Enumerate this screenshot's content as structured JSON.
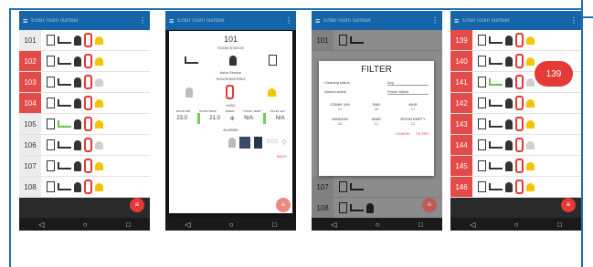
{
  "colors": {
    "accent": "#1565a8",
    "alert": "#e53935",
    "bell": "#f5c400"
  },
  "search": {
    "placeholder": "Enter room number"
  },
  "phone1": {
    "rooms": [
      {
        "num": "101",
        "red": false,
        "bed_green": false
      },
      {
        "num": "102",
        "red": true,
        "bed_green": false
      },
      {
        "num": "103",
        "red": true,
        "bed_green": false
      },
      {
        "num": "104",
        "red": true,
        "bed_green": false
      },
      {
        "num": "105",
        "red": false,
        "bed_green": true
      },
      {
        "num": "106",
        "red": false,
        "bed_green": false
      },
      {
        "num": "107",
        "red": false,
        "bed_green": false
      },
      {
        "num": "108",
        "red": false,
        "bed_green": false
      }
    ]
  },
  "phone2": {
    "room": "101",
    "room_status": "ROOM STATUS",
    "status_text": "Asha Service",
    "housekeeping": "HOUSEKEEPING",
    "hvac": "HVAC",
    "labels": [
      "ROOM SET",
      "ROOM TEMP",
      "SPEED",
      "TOILET TEMP",
      "TOILET SET"
    ],
    "values": [
      "23.0",
      "21.0",
      "",
      "N/A",
      "N/A"
    ],
    "alarms": "ALARMS",
    "sos": "SOS",
    "back": "BACK"
  },
  "phone3": {
    "title": "FILTER",
    "cleaning_label": "Cleaning status",
    "cleaning_val": "Any",
    "alarms_label": "Alarms active",
    "alarms_val": "Power failure",
    "toggles": [
      "COMM. N/A",
      "DND",
      "MUR",
      "WINDOW",
      "MAID",
      "ROOM EMPTY"
    ],
    "cancel": "CANCEL",
    "filter": "FILTER",
    "rooms": [
      "101",
      "107",
      "108"
    ]
  },
  "phone4": {
    "badge": "139",
    "rooms": [
      "139",
      "140",
      "141",
      "142",
      "143",
      "144",
      "145",
      "146"
    ]
  },
  "nav": {
    "back": "◁",
    "home": "○",
    "recent": "□"
  }
}
